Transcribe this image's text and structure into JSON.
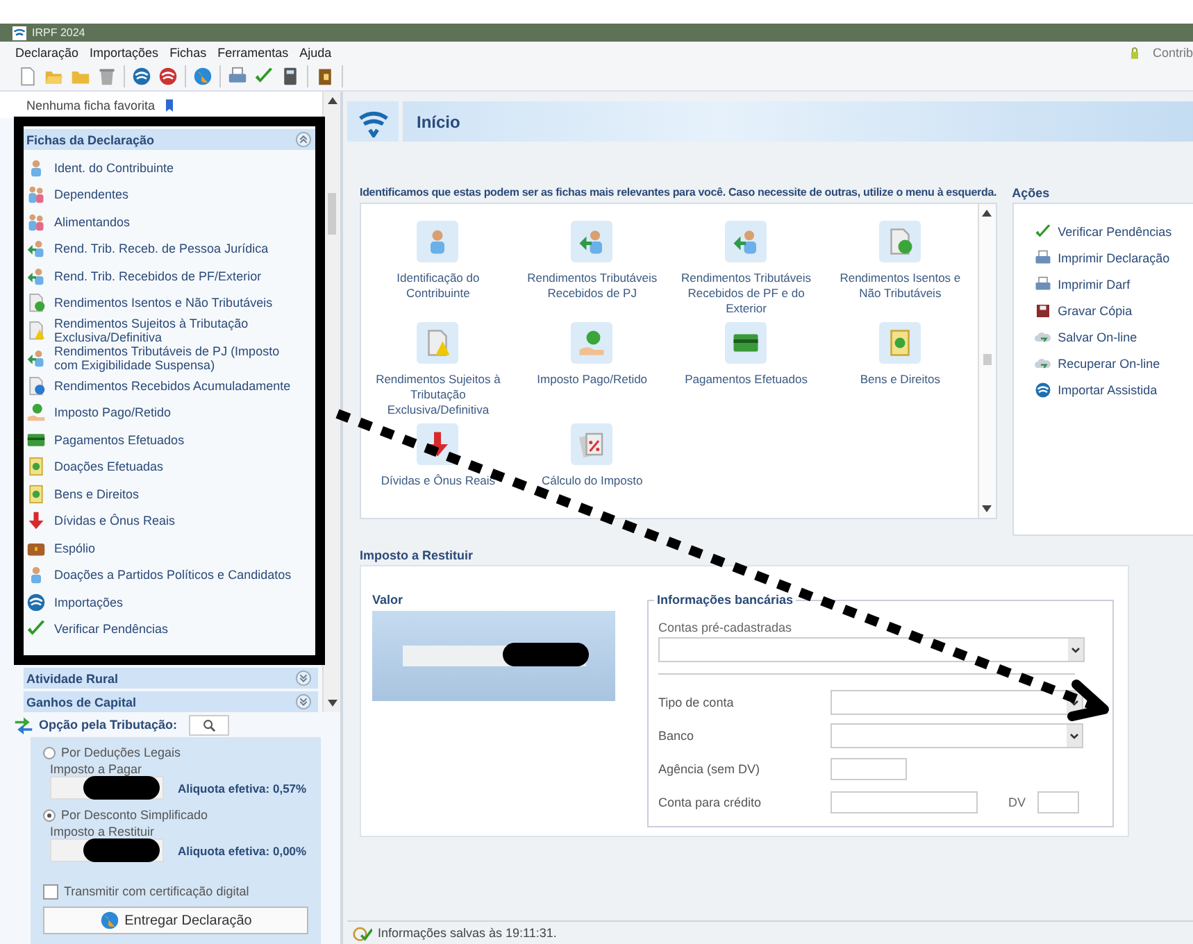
{
  "window": {
    "title": "IRPF 2024"
  },
  "menu": [
    "Declaração",
    "Importações",
    "Fichas",
    "Ferramentas",
    "Ajuda"
  ],
  "user_status": "Contrib",
  "sidebar": {
    "favorites": "Nenhuma ficha favorita",
    "sections": [
      {
        "title": "Fichas da Declaração",
        "expanded": true,
        "items": [
          "Ident. do Contribuinte",
          "Dependentes",
          "Alimentandos",
          "Rend. Trib. Receb. de Pessoa Jurídica",
          "Rend. Trib. Recebidos de PF/Exterior",
          "Rendimentos Isentos e Não Tributáveis",
          "Rendimentos Sujeitos à Tributação Exclusiva/Definitiva",
          "Rendimentos Tributáveis de PJ (Imposto com Exigibilidade Suspensa)",
          "Rendimentos Recebidos Acumuladamente",
          "Imposto Pago/Retido",
          "Pagamentos Efetuados",
          "Doações Efetuadas",
          "Bens e Direitos",
          "Dívidas e Ônus Reais",
          "Espólio",
          "Doações a Partidos Políticos e Candidatos",
          "Importações",
          "Verificar Pendências"
        ]
      },
      {
        "title": "Atividade Rural",
        "expanded": false
      },
      {
        "title": "Ganhos de Capital",
        "expanded": false
      }
    ]
  },
  "tax_option": {
    "title": "Opção pela Tributação:",
    "options": [
      {
        "label": "Por Deduções Legais",
        "selected": false,
        "field_label": "Imposto a Pagar",
        "rate": "Aliquota efetiva: 0,57%"
      },
      {
        "label": "Por Desconto Simplificado",
        "selected": true,
        "field_label": "Imposto a Restituir",
        "rate": "Aliquota efetiva: 0,00%"
      }
    ],
    "certificate": {
      "label": "Transmitir com certificação digital",
      "checked": false
    },
    "submit": "Entregar Declaração"
  },
  "main": {
    "title": "Início",
    "intro": "Identificamos que estas podem ser as fichas mais relevantes para você. Caso necessite de outras, utilize o menu à esquerda.",
    "tiles": [
      "Identificação do Contribuinte",
      "Rendimentos Tributáveis Recebidos de PJ",
      "Rendimentos Tributáveis Recebidos de PF e do Exterior",
      "Rendimentos Isentos e Não Tributáveis",
      "Rendimentos Sujeitos à Tributação Exclusiva/Definitiva",
      "Imposto Pago/Retido",
      "Pagamentos Efetuados",
      "Bens e Direitos",
      "Dívidas e Ônus Reais",
      "Cálculo do Imposto"
    ],
    "actions_title": "Ações",
    "actions": [
      "Verificar Pendências",
      "Imprimir Declaração",
      "Imprimir Darf",
      "Gravar Cópia",
      "Salvar On-line",
      "Recuperar On-line",
      "Importar Assistida"
    ]
  },
  "refund": {
    "title": "Imposto a Restituir",
    "value_label": "Valor",
    "bank": {
      "title": "Informações bancárias",
      "preset_label": "Contas pré-cadastradas",
      "fields": [
        {
          "label": "Tipo de conta",
          "kind": "select"
        },
        {
          "label": "Banco",
          "kind": "select"
        },
        {
          "label": "Agência (sem DV)",
          "kind": "short"
        },
        {
          "label": "Conta para crédito",
          "kind": "account",
          "extra_label": "DV"
        }
      ]
    }
  },
  "status_bar": "Informações salvas às 19:11:31."
}
